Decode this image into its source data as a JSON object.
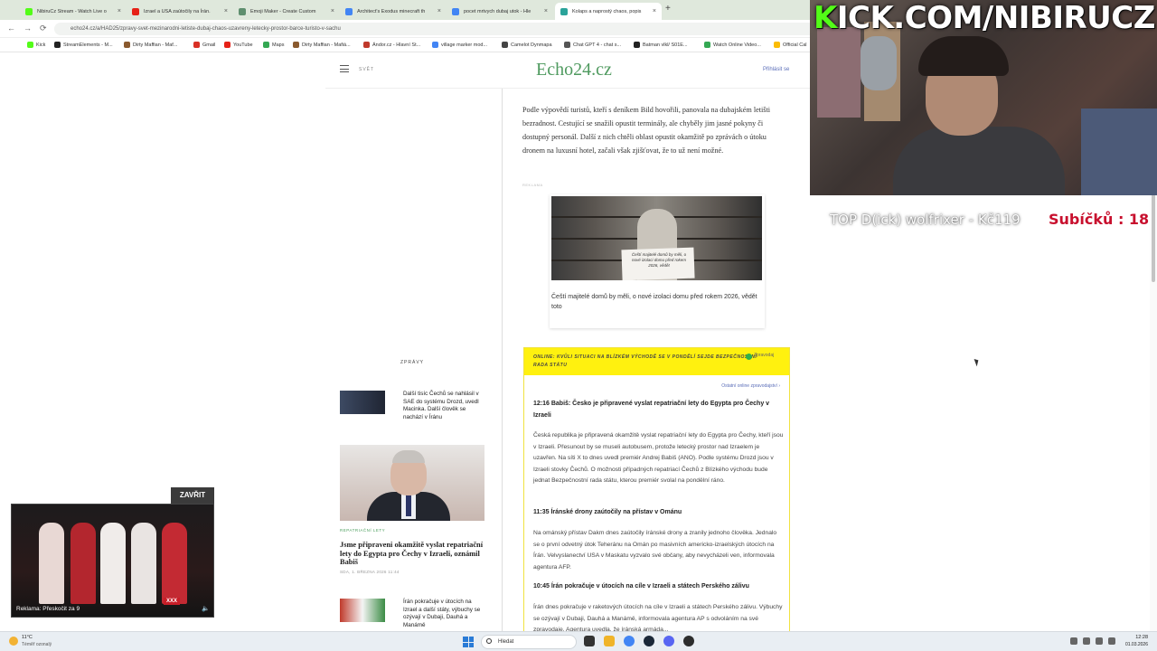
{
  "browser": {
    "tabs": [
      {
        "label": "NibiruCz Stream - Watch Live o",
        "color": "#53fc18"
      },
      {
        "label": "Izrael a USA zaútočily na Írán. ",
        "color": "#e62117"
      },
      {
        "label": "Emoji Maker - Create Custom ",
        "color": "#5f8f6f"
      },
      {
        "label": "Architect's Exodus minecraft th",
        "color": "#4285f4"
      },
      {
        "label": "pocet mrtvych dubaj utok - Hle",
        "color": "#4285f4"
      },
      {
        "label": "Kolaps a naprostý chaos, popis",
        "color": "#2aa39a"
      }
    ],
    "new_tab": "+",
    "tab_close": "×",
    "nav_back": "←",
    "nav_forward": "→",
    "nav_reload": "⟳",
    "url": "echo24.cz/a/HAD25/zpravy-svet-mezinarodni-letiste-dubaj-chaos-uzavreny-letecky-prostor-barce-turisto-v-sachu",
    "bookmarks": [
      {
        "label": "Kick",
        "color": "#53fc18"
      },
      {
        "label": "StreamElements - M...",
        "color": "#222"
      },
      {
        "label": "Dirty Maffian - Maf...",
        "color": "#8a5a2e"
      },
      {
        "label": "Gmail",
        "color": "#d93025"
      },
      {
        "label": "YouTube",
        "color": "#e62117"
      },
      {
        "label": "Maps",
        "color": "#34a853"
      },
      {
        "label": "Dirty Maffian - Mafiá...",
        "color": "#8a5a2e"
      },
      {
        "label": "Ándor.cz - Hlavní St...",
        "color": "#c0392b"
      },
      {
        "label": "village marker mod...",
        "color": "#4285f4"
      },
      {
        "label": "Camelot Dynmapa",
        "color": "#444"
      },
      {
        "label": "Chat GPT 4 - chat s...",
        "color": "#555"
      },
      {
        "label": "Batman vlkl/ S01E...",
        "color": "#222"
      },
      {
        "label": "Watch Online Video...",
        "color": "#34a853"
      },
      {
        "label": "Official Cal",
        "color": "#fbbc05"
      }
    ]
  },
  "site": {
    "section": "SVĚT",
    "logo": "Echo24.cz",
    "login": "Přihlásit se"
  },
  "article": {
    "paragraph": "Podle výpovědí turistů, kteří s deníkem Bild hovořili, panovala na dubajském letišti bezradnost. Cestující se snažili opustit terminály, ale chyběly jim jasné pokyny či dostupný personál. Další z nich chtěli oblast opustit okamžitě po zprávách o útoku dronem na luxusní hotel, začali však zjišťovat, že to už není možné.",
    "ad_label": "REKLAMA",
    "ad_sign": "Čeští majitelé domů by měli, o nové izolaci domu před rokem 2026, vědět",
    "ad_caption": "Čeští majitelé domů by měli, o nové izolaci domu před rokem 2026, vědět toto"
  },
  "sidebar": {
    "heading": "ZPRÁVY",
    "news": [
      {
        "title": "Další tisíc Čechů se nahlásil v SAE do systému Drozd, uvedl Macinka. Další člověk se nachází v Íránu"
      },
      {
        "title": "Írán pokračuje v útocích na Izrael a další státy, výbuchy se ozývají v Dubaji, Dauhá a Manámě"
      }
    ],
    "featured": {
      "category": "REPATRIAČNÍ LETY",
      "title": "Jsme připraveni okamžitě vyslat repatriační lety do Egypta pro Čechy v Izraeli, oznámil Babiš",
      "meta": "SDA, 1. BŘEZNA 2026 11:44"
    }
  },
  "live": {
    "heading": "ONLINE: KVŮLI SITUACI NA BLÍZKÉM VÝCHODĚ SE V PONDĚLÍ SEJDE BEZPEČNOSTNÍ RADA STÁTU",
    "prefix": "Zpravodaj",
    "other_link": "Ostatní online zpravodajství  ›",
    "entries": [
      {
        "title": "12:16 Babiš: Česko je připravené vyslat repatriační lety do Egypta pro Čechy v Izraeli",
        "body": "Česká republika je připravená okamžitě vyslat repatriační lety do Egypta pro Čechy, kteří jsou v Izraeli. Přesunout by se museli autobusem, protože letecký prostor nad Izraelem je uzavřen. Na síti X to dnes uvedl premiér Andrej Babiš (ANO). Podle systému Drozd jsou v Izraeli stovky Čechů. O možnosti případných repatriací Čechů z Blízkého východu bude jednat Bezpečnostní rada státu, kterou premiér svolal na pondělní ráno."
      },
      {
        "title": "11:35 Íránské drony zaútočily na přístav v Ománu",
        "body": "Na ománský přístav Dakm dnes zaútočily íránské drony a zranily jednoho člověka. Jednalo se o první odvetný útok Teheránu na Omán po masivních americko-izraelských útocích na Írán. Velvyslanectví USA v Maskatu vyzvalo své občany, aby nevycházeli ven, informovala agentura AFP."
      },
      {
        "title": "10:45 Írán pokračuje v útocích na cíle v Izraeli a státech Perského zálivu",
        "body": "Írán dnes pokračuje v raketových útocích na cíle v Izraeli a státech Perského zálivu. Výbuchy se ozývají v Dubaji, Dauhá a Manámě, informovala agentura AP s odvoláním na své zpravodaje. Agentura uvedla, že íránská armáda..."
      }
    ]
  },
  "overlay": {
    "kick_url_k": "K",
    "kick_url_rest": "ICK.COM/NIBIRUCZ",
    "top_donor": "TOP D(ick) wolfrixer - Kč119",
    "subs": "Subíčků : 18"
  },
  "video_ad": {
    "close": "ZAVŘIT",
    "label": "Reklama: Přeskočit za 9",
    "logo": "XXX",
    "volume": "🔈"
  },
  "taskbar": {
    "temp": "11°C",
    "weather": "Téměř ozonalý",
    "search": "Hledat",
    "time": "12:28",
    "date": "01.03.2026"
  }
}
